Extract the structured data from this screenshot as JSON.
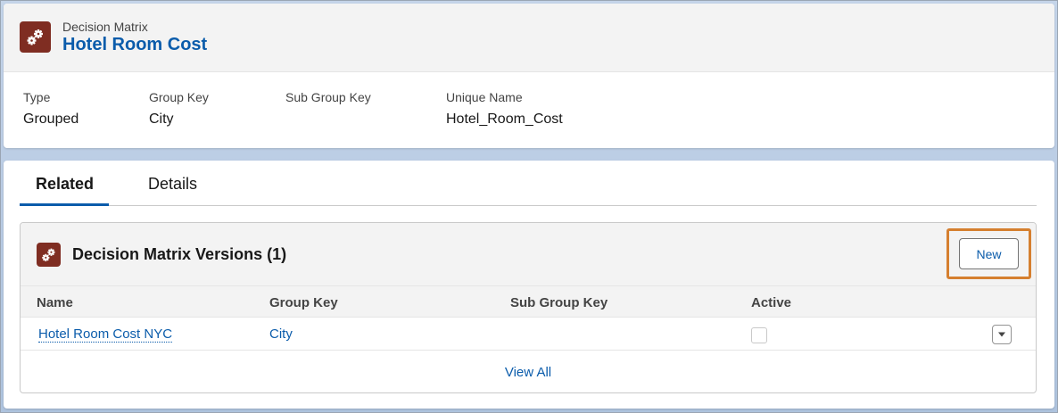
{
  "header": {
    "object_type": "Decision Matrix",
    "record_name": "Hotel Room Cost",
    "icon": "gears-icon",
    "fields": [
      {
        "label": "Type",
        "value": "Grouped"
      },
      {
        "label": "Group Key",
        "value": "City"
      },
      {
        "label": "Sub Group Key",
        "value": ""
      },
      {
        "label": "Unique Name",
        "value": "Hotel_Room_Cost"
      }
    ]
  },
  "tabs": [
    {
      "label": "Related",
      "active": true
    },
    {
      "label": "Details",
      "active": false
    }
  ],
  "related_list": {
    "title": "Decision Matrix Versions (1)",
    "icon": "gears-icon",
    "new_label": "New",
    "columns": [
      "Name",
      "Group Key",
      "Sub Group Key",
      "Active"
    ],
    "rows": [
      {
        "name": "Hotel Room Cost NYC",
        "group_key": "City",
        "sub_group_key": "",
        "active": false
      }
    ],
    "view_all_label": "View All"
  },
  "colors": {
    "accent": "#0b5cab",
    "icon_bg": "#7f2d22",
    "highlight": "#d57f2f"
  }
}
